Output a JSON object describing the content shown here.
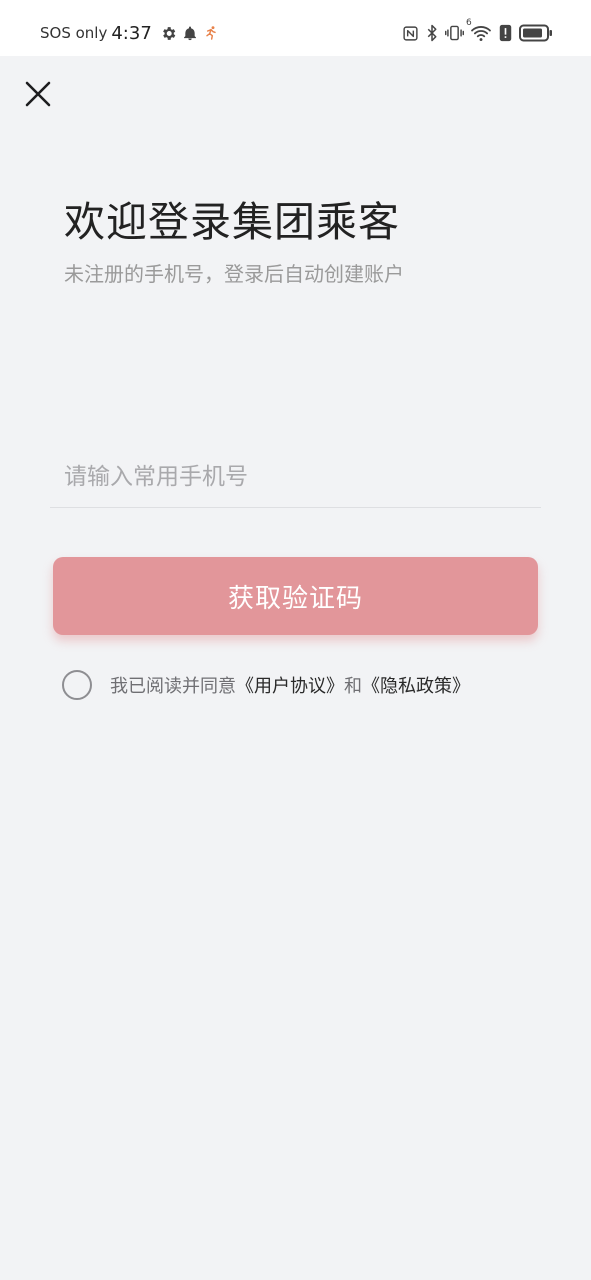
{
  "status_bar": {
    "carrier": "SOS only",
    "time": "4:37",
    "icons_left": [
      "gear-icon",
      "bell-icon",
      "runner-icon"
    ],
    "icons_right": [
      "nfc-icon",
      "bluetooth-icon",
      "vibrate-icon",
      "wifi-icon",
      "alert-icon",
      "battery-icon"
    ],
    "wifi_badge": "6"
  },
  "header": {
    "close_icon": "close-icon"
  },
  "main": {
    "title": "欢迎登录集团乘客",
    "subtitle": "未注册的手机号，登录后自动创建账户",
    "phone_placeholder": "请输入常用手机号",
    "phone_value": "",
    "button_label": "获取验证码",
    "button_color": "#e2969a",
    "agreement": {
      "prefix": "我已阅读并同意",
      "terms": "《用户协议》",
      "and": "和",
      "privacy": "《隐私政策》",
      "checked": false
    }
  }
}
